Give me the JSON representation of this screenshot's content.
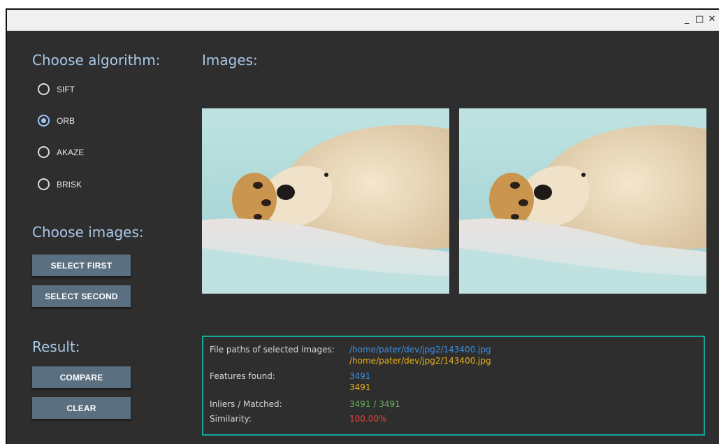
{
  "window": {
    "controls": {
      "minimize": "_",
      "maximize": "□",
      "close": "✕"
    }
  },
  "sidebar": {
    "algorithm_title": "Choose algorithm:",
    "algorithms": [
      {
        "label": "SIFT",
        "checked": false
      },
      {
        "label": "ORB",
        "checked": true
      },
      {
        "label": "AKAZE",
        "checked": false
      },
      {
        "label": "BRISK",
        "checked": false
      }
    ],
    "images_title": "Choose images:",
    "select_first_label": "SELECT FIRST",
    "select_second_label": "SELECT SECOND",
    "result_title": "Result:",
    "compare_label": "COMPARE",
    "clear_label": "CLEAR"
  },
  "main": {
    "images_title": "Images:"
  },
  "results": {
    "paths_label": "File paths of selected images:",
    "path_first": "/home/pater/dev/jpg2/143400.jpg",
    "path_second": "/home/pater/dev/jpg2/143400.jpg",
    "features_label": "Features found:",
    "features_first": "3491",
    "features_second": "3491",
    "inliers_label": "Inliers / Matched:",
    "inliers_value": "3491 / 3491",
    "similarity_label": "Similarity:",
    "similarity_value": "100.00%"
  },
  "colors": {
    "accent_title": "#a9c8e8",
    "first_image": "#3f8fe0",
    "second_image": "#e8b21c",
    "inliers": "#67b35a",
    "similarity": "#e2453a",
    "border": "#16a59a"
  }
}
